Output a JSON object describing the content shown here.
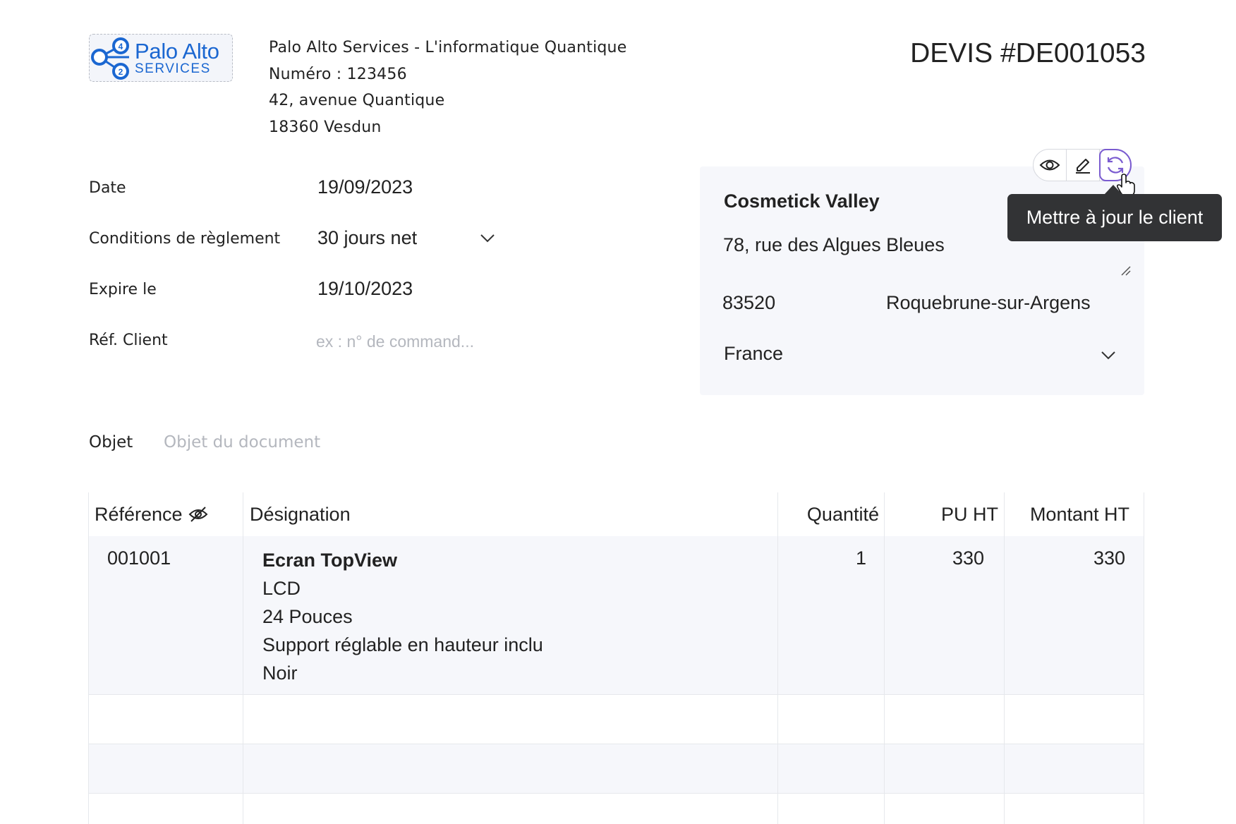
{
  "company": {
    "logo_name": "Palo Alto",
    "logo_sub": "SERVICES",
    "logo_badges": [
      "4",
      "2"
    ],
    "name_line": "Palo Alto Services - L'informatique Quantique",
    "number_line": "Numéro : 123456",
    "address_line": "42, avenue Quantique",
    "city_line": "18360 Vesdun"
  },
  "document": {
    "title": "DEVIS #DE001053"
  },
  "fields": {
    "date": {
      "label": "Date",
      "value": "19/09/2023"
    },
    "payment_terms": {
      "label": "Conditions de règlement",
      "value": "30 jours net"
    },
    "expires": {
      "label": "Expire le",
      "value": "19/10/2023"
    },
    "client_ref": {
      "label": "Réf. Client",
      "placeholder": "ex : n° de command..."
    }
  },
  "client": {
    "name": "Cosmetick Valley",
    "address": "78, rue des Algues Bleues",
    "postcode": "83520",
    "city": "Roquebrune-sur-Argens",
    "country": "France"
  },
  "toolbar": {
    "icons": [
      "eye-icon",
      "pencil-icon",
      "refresh-icon"
    ],
    "active": "refresh-icon"
  },
  "tooltip": {
    "text": "Mettre à jour le client"
  },
  "object": {
    "label": "Objet",
    "placeholder": "Objet du document"
  },
  "table": {
    "headers": {
      "reference": "Référence",
      "designation": "Désignation",
      "quantity": "Quantité",
      "unit_price": "PU HT",
      "amount": "Montant HT"
    },
    "rows": [
      {
        "reference": "001001",
        "designation_title": "Ecran TopView",
        "designation_lines": [
          "LCD",
          "24 Pouces",
          "Support réglable en hauteur inclu",
          "Noir"
        ],
        "quantity": "1",
        "unit_price": "330",
        "amount": "330"
      }
    ]
  },
  "colors": {
    "brand": "#1b67d1",
    "accent": "#7a5bd0",
    "tooltip_bg": "#323335",
    "card_bg": "#f6f7fb",
    "placeholder": "#b4b7be"
  }
}
